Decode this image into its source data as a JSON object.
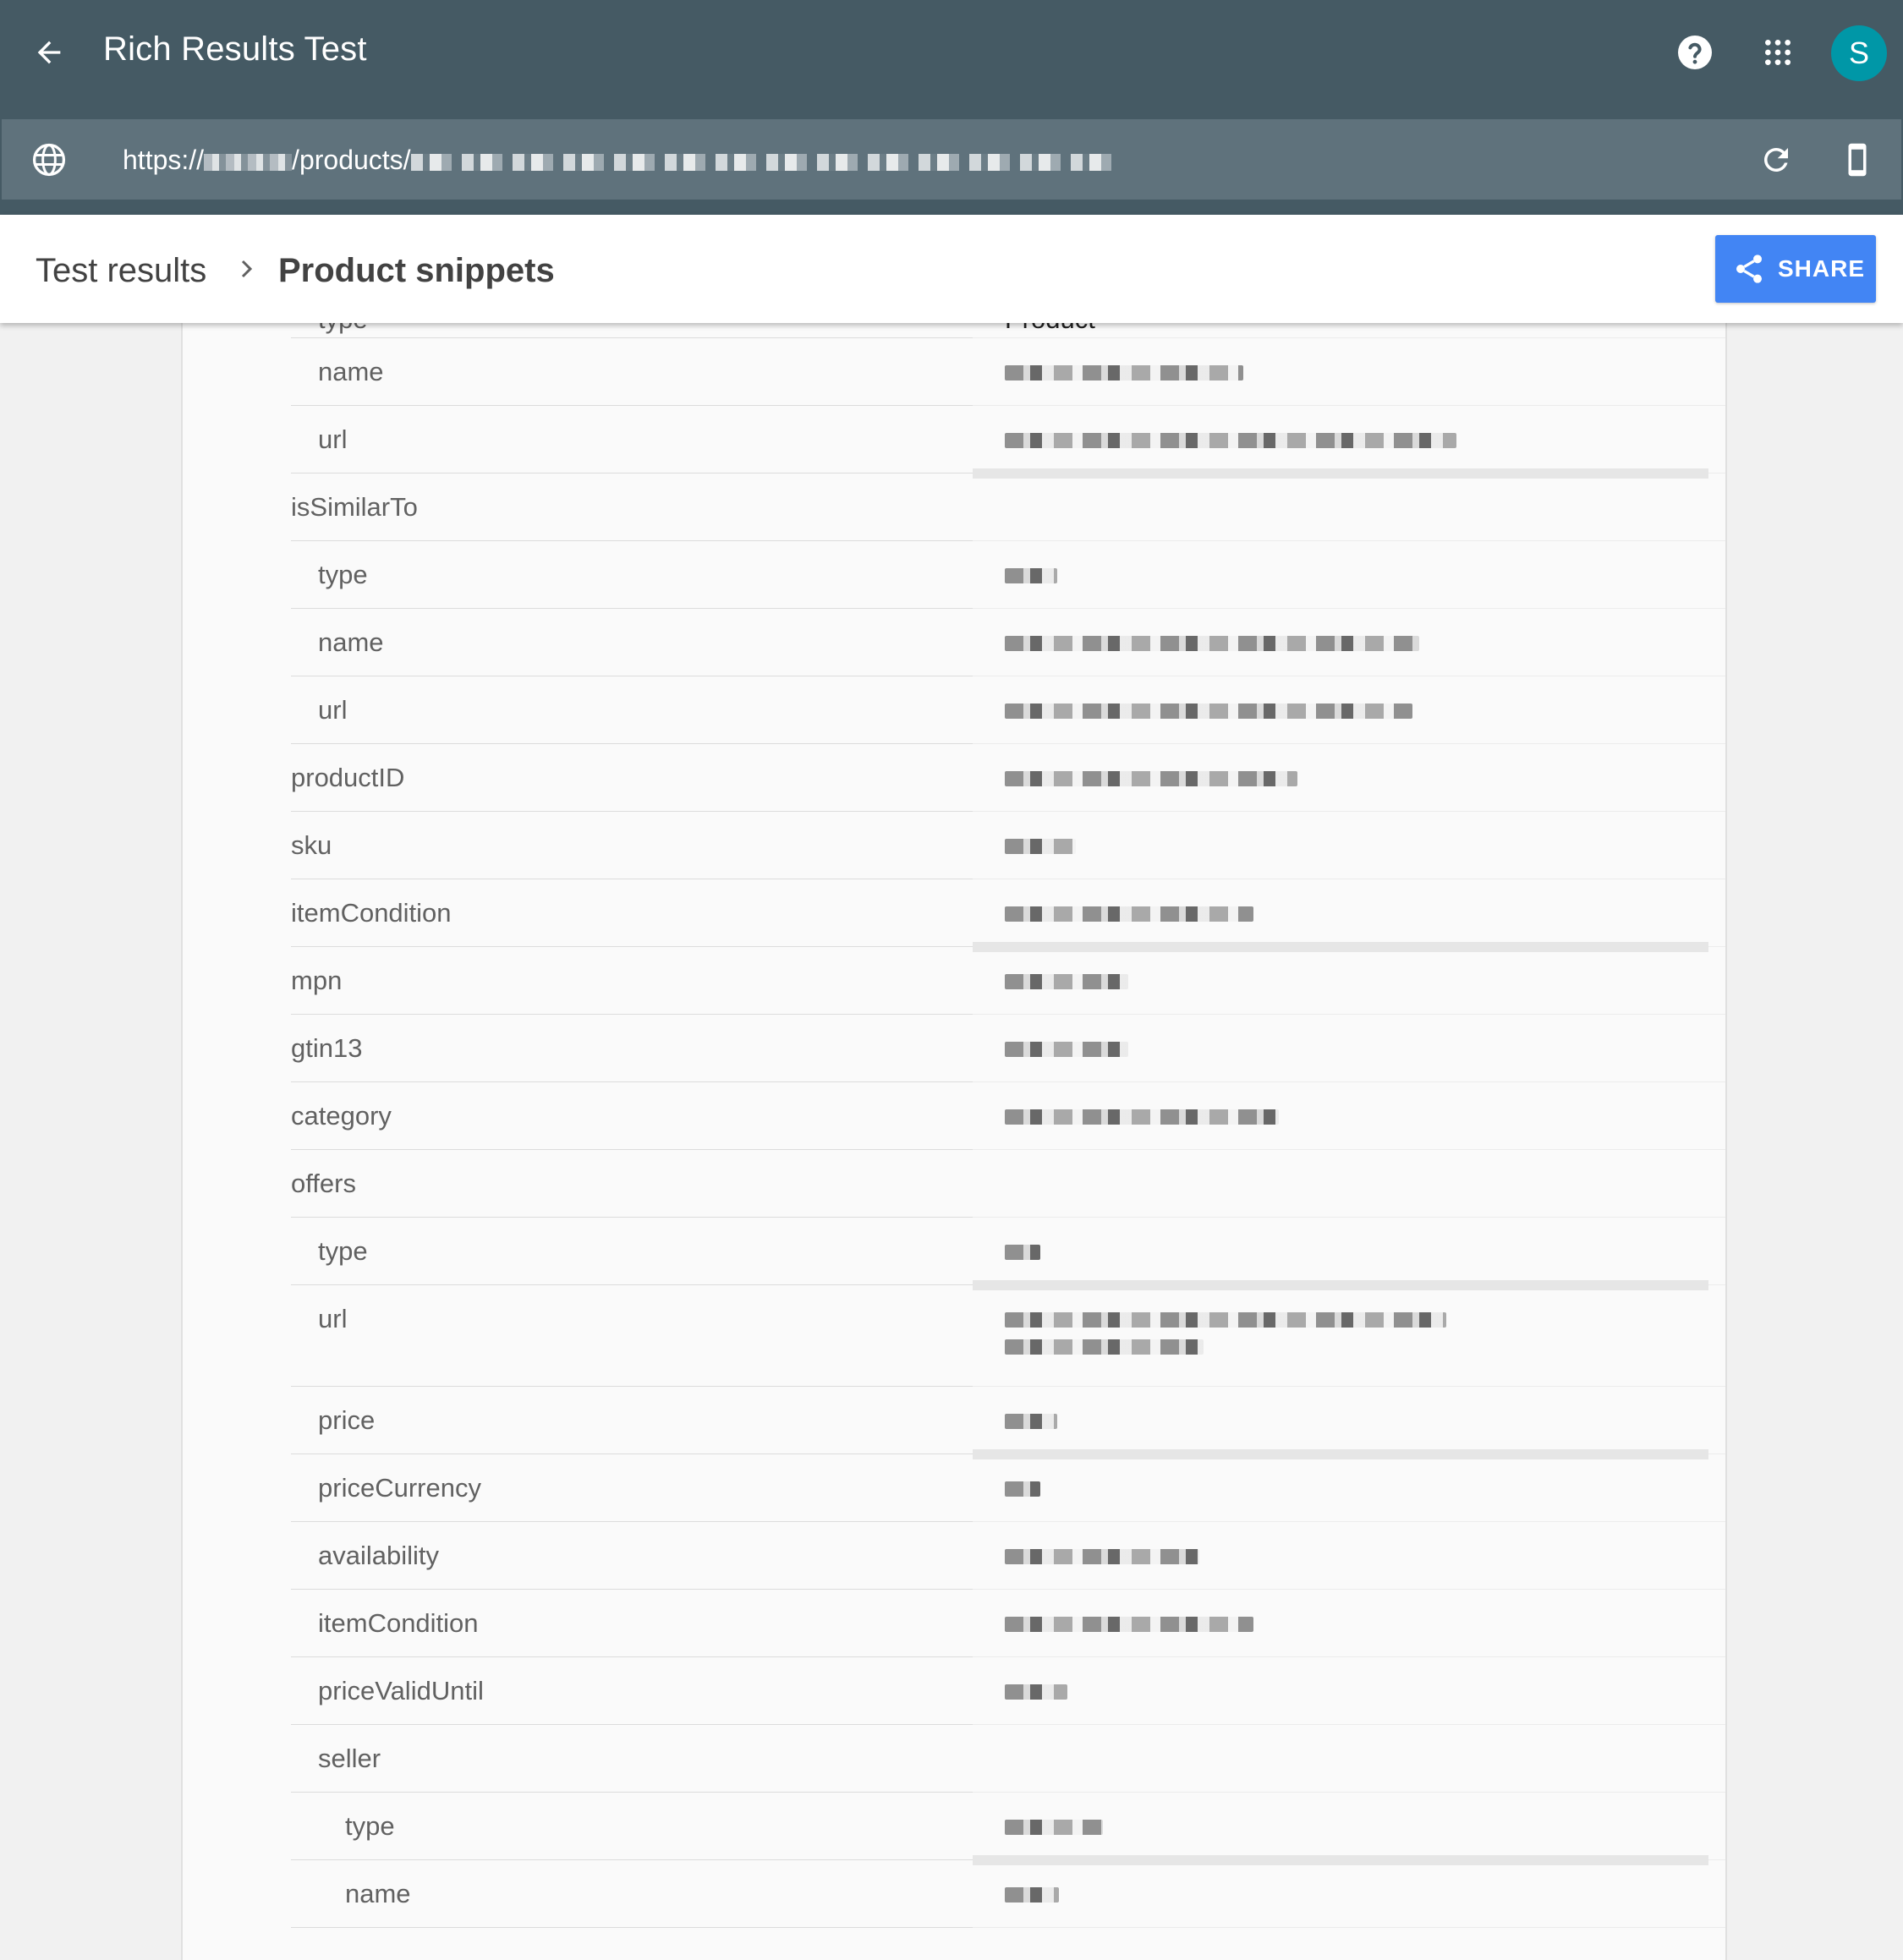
{
  "app": {
    "title": "Rich Results Test",
    "avatar_letter": "S",
    "url_prefix": "https://",
    "url_path": "/products/"
  },
  "breadcrumb": {
    "parent": "Test results",
    "current": "Product snippets"
  },
  "toolbar": {
    "share_label": "SHARE"
  },
  "colors": {
    "app_bar": "#455a64",
    "url_bar": "#5f727c",
    "share_button": "#4285f4",
    "avatar": "#0097a7"
  },
  "icons": {
    "back": "arrow-left-icon",
    "help": "help-circle-icon",
    "apps": "apps-grid-icon",
    "globe": "globe-icon",
    "refresh": "refresh-icon",
    "device": "smartphone-icon",
    "share": "share-icon",
    "breadcrumb_separator": "chevron-right-icon"
  },
  "partial_top_row": {
    "property": "type",
    "value": "Product"
  },
  "properties": [
    {
      "label": "name",
      "indent": 1,
      "has_value": true
    },
    {
      "label": "url",
      "indent": 1,
      "has_value": true
    },
    {
      "label": "isSimilarTo",
      "indent": 0,
      "has_value": false
    },
    {
      "label": "type",
      "indent": 1,
      "has_value": true
    },
    {
      "label": "name",
      "indent": 1,
      "has_value": true
    },
    {
      "label": "url",
      "indent": 1,
      "has_value": true
    },
    {
      "label": "productID",
      "indent": 0,
      "has_value": true
    },
    {
      "label": "sku",
      "indent": 0,
      "has_value": true
    },
    {
      "label": "itemCondition",
      "indent": 0,
      "has_value": true
    },
    {
      "label": "mpn",
      "indent": 0,
      "has_value": true
    },
    {
      "label": "gtin13",
      "indent": 0,
      "has_value": true
    },
    {
      "label": "category",
      "indent": 0,
      "has_value": true
    },
    {
      "label": "offers",
      "indent": 0,
      "has_value": false
    },
    {
      "label": "type",
      "indent": 1,
      "has_value": true
    },
    {
      "label": "url",
      "indent": 1,
      "has_value": true,
      "lines": 2
    },
    {
      "label": "price",
      "indent": 1,
      "has_value": true
    },
    {
      "label": "priceCurrency",
      "indent": 1,
      "has_value": true
    },
    {
      "label": "availability",
      "indent": 1,
      "has_value": true
    },
    {
      "label": "itemCondition",
      "indent": 1,
      "has_value": true
    },
    {
      "label": "priceValidUntil",
      "indent": 1,
      "has_value": true
    },
    {
      "label": "seller",
      "indent": 1,
      "has_value": false
    },
    {
      "label": "type",
      "indent": 2,
      "has_value": true
    },
    {
      "label": "name",
      "indent": 2,
      "has_value": true
    }
  ]
}
